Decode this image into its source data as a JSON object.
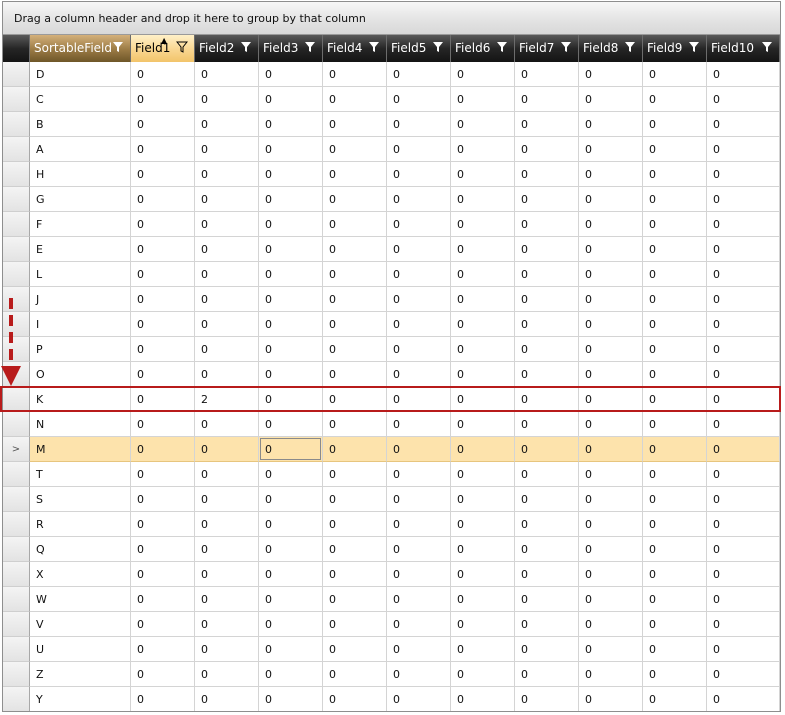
{
  "group_panel": {
    "hint": "Drag a column header and drop it here to group by that column"
  },
  "columns": [
    {
      "label": "SortableField",
      "filter": true,
      "state": "sortable"
    },
    {
      "label": "Field1",
      "filter": true,
      "state": "sorted",
      "sort_direction": "ascending"
    },
    {
      "label": "Field2",
      "filter": true
    },
    {
      "label": "Field3",
      "filter": true
    },
    {
      "label": "Field4",
      "filter": true
    },
    {
      "label": "Field5",
      "filter": true
    },
    {
      "label": "Field6",
      "filter": true
    },
    {
      "label": "Field7",
      "filter": true
    },
    {
      "label": "Field8",
      "filter": true
    },
    {
      "label": "Field9",
      "filter": true
    },
    {
      "label": "Field10",
      "filter": true
    }
  ],
  "rows": [
    {
      "key": "D",
      "values": [
        "0",
        "0",
        "0",
        "0",
        "0",
        "0",
        "0",
        "0",
        "0",
        "0"
      ]
    },
    {
      "key": "C",
      "values": [
        "0",
        "0",
        "0",
        "0",
        "0",
        "0",
        "0",
        "0",
        "0",
        "0"
      ]
    },
    {
      "key": "B",
      "values": [
        "0",
        "0",
        "0",
        "0",
        "0",
        "0",
        "0",
        "0",
        "0",
        "0"
      ]
    },
    {
      "key": "A",
      "values": [
        "0",
        "0",
        "0",
        "0",
        "0",
        "0",
        "0",
        "0",
        "0",
        "0"
      ]
    },
    {
      "key": "H",
      "values": [
        "0",
        "0",
        "0",
        "0",
        "0",
        "0",
        "0",
        "0",
        "0",
        "0"
      ]
    },
    {
      "key": "G",
      "values": [
        "0",
        "0",
        "0",
        "0",
        "0",
        "0",
        "0",
        "0",
        "0",
        "0"
      ]
    },
    {
      "key": "F",
      "values": [
        "0",
        "0",
        "0",
        "0",
        "0",
        "0",
        "0",
        "0",
        "0",
        "0"
      ]
    },
    {
      "key": "E",
      "values": [
        "0",
        "0",
        "0",
        "0",
        "0",
        "0",
        "0",
        "0",
        "0",
        "0"
      ]
    },
    {
      "key": "L",
      "values": [
        "0",
        "0",
        "0",
        "0",
        "0",
        "0",
        "0",
        "0",
        "0",
        "0"
      ]
    },
    {
      "key": "J",
      "values": [
        "0",
        "0",
        "0",
        "0",
        "0",
        "0",
        "0",
        "0",
        "0",
        "0"
      ]
    },
    {
      "key": "I",
      "values": [
        "0",
        "0",
        "0",
        "0",
        "0",
        "0",
        "0",
        "0",
        "0",
        "0"
      ]
    },
    {
      "key": "P",
      "values": [
        "0",
        "0",
        "0",
        "0",
        "0",
        "0",
        "0",
        "0",
        "0",
        "0"
      ]
    },
    {
      "key": "O",
      "values": [
        "0",
        "0",
        "0",
        "0",
        "0",
        "0",
        "0",
        "0",
        "0",
        "0"
      ]
    },
    {
      "key": "K",
      "values": [
        "0",
        "2",
        "0",
        "0",
        "0",
        "0",
        "0",
        "0",
        "0",
        "0"
      ],
      "annotated": true
    },
    {
      "key": "N",
      "values": [
        "0",
        "0",
        "0",
        "0",
        "0",
        "0",
        "0",
        "0",
        "0",
        "0"
      ]
    },
    {
      "key": "M",
      "values": [
        "0",
        "0",
        "0",
        "0",
        "0",
        "0",
        "0",
        "0",
        "0",
        "0"
      ],
      "current": true,
      "focused_col": 3
    },
    {
      "key": "T",
      "values": [
        "0",
        "0",
        "0",
        "0",
        "0",
        "0",
        "0",
        "0",
        "0",
        "0"
      ]
    },
    {
      "key": "S",
      "values": [
        "0",
        "0",
        "0",
        "0",
        "0",
        "0",
        "0",
        "0",
        "0",
        "0"
      ]
    },
    {
      "key": "R",
      "values": [
        "0",
        "0",
        "0",
        "0",
        "0",
        "0",
        "0",
        "0",
        "0",
        "0"
      ]
    },
    {
      "key": "Q",
      "values": [
        "0",
        "0",
        "0",
        "0",
        "0",
        "0",
        "0",
        "0",
        "0",
        "0"
      ]
    },
    {
      "key": "X",
      "values": [
        "0",
        "0",
        "0",
        "0",
        "0",
        "0",
        "0",
        "0",
        "0",
        "0"
      ]
    },
    {
      "key": "W",
      "values": [
        "0",
        "0",
        "0",
        "0",
        "0",
        "0",
        "0",
        "0",
        "0",
        "0"
      ]
    },
    {
      "key": "V",
      "values": [
        "0",
        "0",
        "0",
        "0",
        "0",
        "0",
        "0",
        "0",
        "0",
        "0"
      ]
    },
    {
      "key": "U",
      "values": [
        "0",
        "0",
        "0",
        "0",
        "0",
        "0",
        "0",
        "0",
        "0",
        "0"
      ]
    },
    {
      "key": "Z",
      "values": [
        "0",
        "0",
        "0",
        "0",
        "0",
        "0",
        "0",
        "0",
        "0",
        "0"
      ]
    },
    {
      "key": "Y",
      "values": [
        "0",
        "0",
        "0",
        "0",
        "0",
        "0",
        "0",
        "0",
        "0",
        "0"
      ]
    }
  ],
  "current_row_indicator": ">",
  "colors": {
    "current_row": "#fde3ac",
    "annotation": "#b81b1b",
    "header_dark": "#1a1a1a"
  }
}
